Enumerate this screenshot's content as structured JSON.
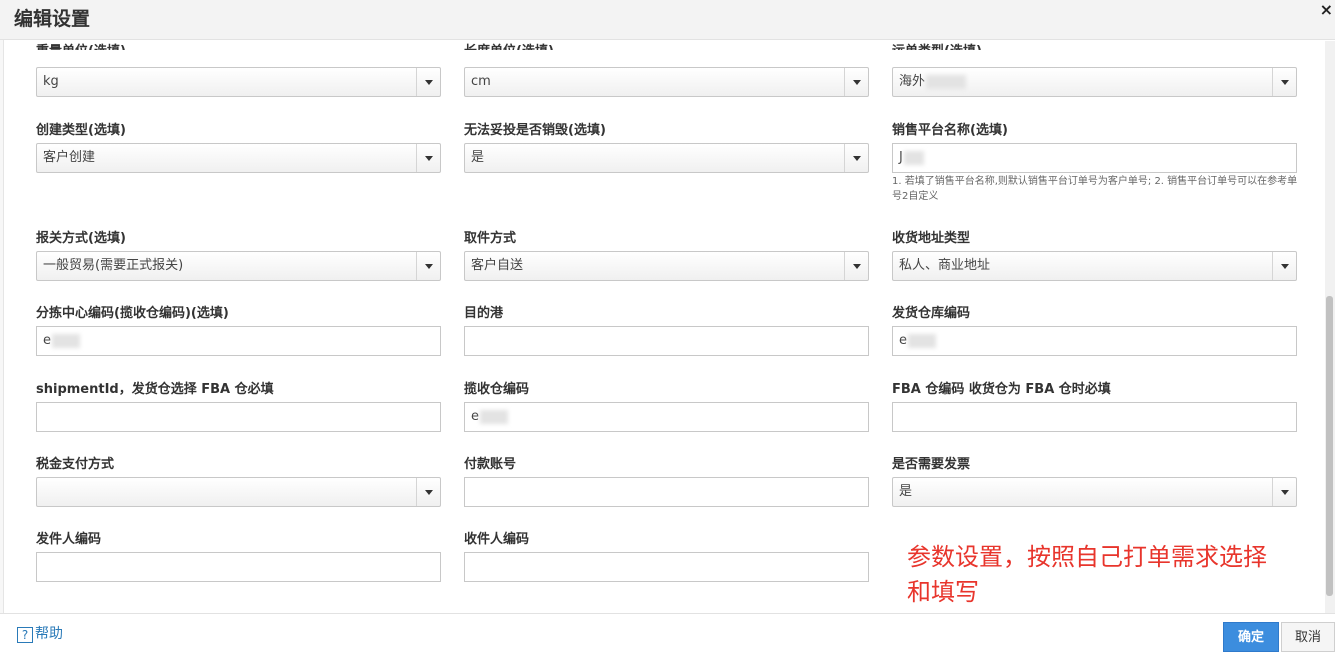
{
  "header": {
    "title": "编辑设置",
    "close": "×"
  },
  "fields": {
    "weight_unit": {
      "label": "重量单位(选填)",
      "value": "kg"
    },
    "length_unit": {
      "label": "长度单位(选填)",
      "value": "cm"
    },
    "shipment_type": {
      "label": "运单类型(选填)",
      "value": "海外"
    },
    "create_type": {
      "label": "创建类型(选填)",
      "value": "客户创建"
    },
    "destroy_if_undeliverable": {
      "label": "无法妥投是否销毁(选填)",
      "value": "是"
    },
    "platform_name": {
      "label": "销售平台名称(选填)",
      "value": "J",
      "hint": "1. 若填了销售平台名称,则默认销售平台订单号为客户单号; 2. 销售平台订单号可以在参考单号2自定义"
    },
    "customs_mode": {
      "label": "报关方式(选填)",
      "value": "一般贸易(需要正式报关)"
    },
    "pickup_mode": {
      "label": "取件方式",
      "value": "客户自送"
    },
    "address_type": {
      "label": "收货地址类型",
      "value": "私人、商业地址"
    },
    "sorting_center_code": {
      "label": "分拣中心编码(揽收仓编码)(选填)",
      "value": "e"
    },
    "destination_port": {
      "label": "目的港",
      "value": ""
    },
    "warehouse_code": {
      "label": "发货仓库编码",
      "value": "e"
    },
    "shipment_id": {
      "label": "shipmentId，发货仓选择 FBA 仓必填",
      "value": ""
    },
    "collect_warehouse_code": {
      "label": "揽收仓编码",
      "value": "e"
    },
    "fba_warehouse_code": {
      "label": "FBA 仓编码 收货仓为 FBA 仓时必填",
      "value": ""
    },
    "tax_payment": {
      "label": "税金支付方式",
      "value": ""
    },
    "payment_account": {
      "label": "付款账号",
      "value": ""
    },
    "need_invoice": {
      "label": "是否需要发票",
      "value": "是"
    },
    "sender_code": {
      "label": "发件人编码",
      "value": ""
    },
    "receiver_code": {
      "label": "收件人编码",
      "value": ""
    }
  },
  "annotation": {
    "line1": "参数设置，按照自己打单需求选择",
    "line2": "和填写",
    "color": "#e8352c"
  },
  "footer": {
    "help_icon": "?",
    "help": "帮助",
    "confirm": "确定",
    "cancel": "取消"
  }
}
